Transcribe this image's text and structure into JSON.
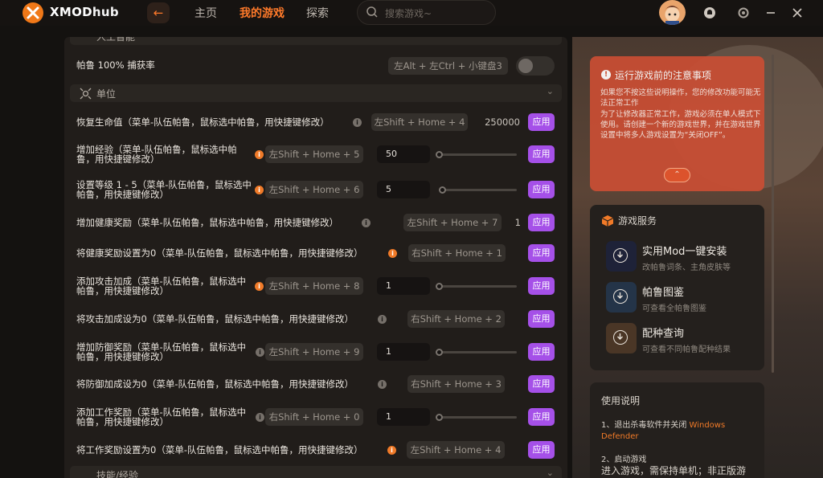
{
  "topbar": {
    "brand_main": "XMOD",
    "brand_sub": "hub",
    "nav": [
      "主页",
      "我的游戏",
      "探索"
    ],
    "search_placeholder": "搜索游戏~",
    "back_icon": "arrow-left-icon",
    "accent": "#ff7a2a"
  },
  "mods": {
    "top_section_partial": "人工智能",
    "capture_rate": {
      "label": "帕鲁 100% 捕获率",
      "hotkey": "左Alt + 左Ctrl + 小键盘3"
    },
    "unit_section": "单位",
    "bottom_section_partial": "技能/经验",
    "apply_label": "应用",
    "rows": [
      {
        "label": "恢复生命值（菜单-队伍帕鲁，鼠标选中帕鲁，用快捷键修改）",
        "hotkey": "左Shift + Home + 4",
        "value": "250000"
      },
      {
        "label": "增加经验（菜单-队伍帕鲁，鼠标选中帕鲁，用快捷键修改）",
        "hotkey": "左Shift + Home + 5",
        "value": "50"
      },
      {
        "label": "设置等级 1 - 5（菜单-队伍帕鲁，鼠标选中帕鲁，用快捷键修改）",
        "hotkey": "左Shift + Home + 6",
        "value": "5"
      },
      {
        "label": "增加健康奖励（菜单-队伍帕鲁，鼠标选中帕鲁，用快捷键修改）",
        "hotkey": "左Shift + Home + 7",
        "value": "1"
      },
      {
        "label": "将健康奖励设置为0（菜单-队伍帕鲁，鼠标选中帕鲁，用快捷键修改）",
        "hotkey": "右Shift + Home + 1"
      },
      {
        "label": "添加攻击加成（菜单-队伍帕鲁，鼠标选中帕鲁，用快捷键修改）",
        "hotkey": "左Shift + Home + 8",
        "value": "1"
      },
      {
        "label": "将攻击加成设为0（菜单-队伍帕鲁，鼠标选中帕鲁，用快捷键修改）",
        "hotkey": "右Shift + Home + 2"
      },
      {
        "label": "增加防御奖励（菜单-队伍帕鲁，鼠标选中帕鲁，用快捷键修改）",
        "hotkey": "左Shift + Home + 9",
        "value": "1"
      },
      {
        "label": "将防御加成设为0（菜单-队伍帕鲁，鼠标选中帕鲁，用快捷键修改）",
        "hotkey": "右Shift + Home + 3"
      },
      {
        "label": "添加工作奖励（菜单-队伍帕鲁，鼠标选中帕鲁，用快捷键修改）",
        "hotkey": "右Shift + Home + 0",
        "value": "1"
      },
      {
        "label": "将工作奖励设置为0（菜单-队伍帕鲁，鼠标选中帕鲁，用快捷键修改）",
        "hotkey": "左Shift + Home + 4"
      }
    ]
  },
  "notice": {
    "title": "运行游戏前的注意事项",
    "body": "如果您不按这些说明操作，您的修改功能可能无法正常工作\n为了让修改器正常工作，游戏必须在单人模式下使用。请创建一个新的游戏世界，并在游戏世界设置中将多人游戏设置为“关闭OFF”。"
  },
  "services": {
    "title": "游戏服务",
    "items": [
      {
        "name": "实用Mod一键安装",
        "desc": "改帕鲁词条、主角皮肤等"
      },
      {
        "name": "帕鲁图鉴",
        "desc": "可查看全帕鲁图鉴"
      },
      {
        "name": "配种查询",
        "desc": "可查看不同帕鲁配种结果"
      }
    ]
  },
  "usage": {
    "title": "使用说明",
    "step1_prefix": "1、退出杀毒软件并关闭 ",
    "step1_highlight": "Windows Defender",
    "step2": "2、启动游戏",
    "step3": "进入游戏，需保持单机；非正版游"
  }
}
